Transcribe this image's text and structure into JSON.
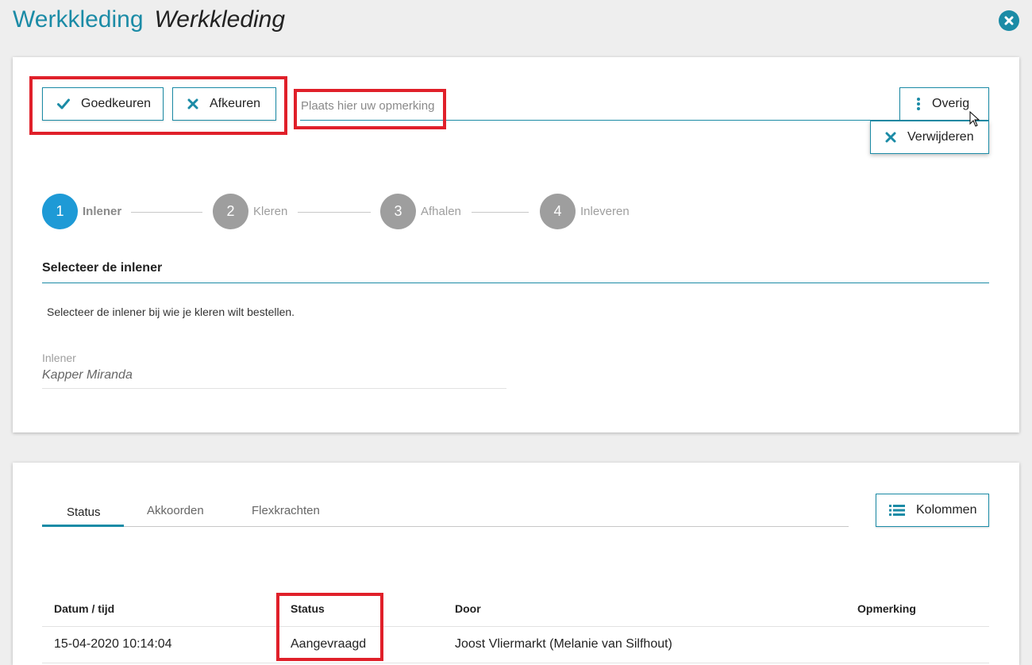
{
  "header": {
    "title": "Werkkleding",
    "subtitle": "Werkkleding"
  },
  "toolbar": {
    "approve_label": "Goedkeuren",
    "reject_label": "Afkeuren",
    "remark_placeholder": "Plaats hier uw opmerking",
    "more_label": "Overig",
    "delete_label": "Verwijderen"
  },
  "stepper": {
    "steps": [
      {
        "number": "1",
        "label": "Inlener",
        "active": true
      },
      {
        "number": "2",
        "label": "Kleren",
        "active": false
      },
      {
        "number": "3",
        "label": "Afhalen",
        "active": false
      },
      {
        "number": "4",
        "label": "Inleveren",
        "active": false
      }
    ]
  },
  "section": {
    "title": "Selecteer de inlener",
    "description": "Selecteer de inlener bij wie je kleren wilt bestellen.",
    "field_label": "Inlener",
    "field_value": "Kapper Miranda"
  },
  "history": {
    "tabs": [
      "Status",
      "Akkoorden",
      "Flexkrachten"
    ],
    "active_tab": "Status",
    "columns_label": "Kolommen",
    "headers": [
      "Datum / tijd",
      "Status",
      "Door",
      "Opmerking"
    ],
    "rows": [
      [
        "15-04-2020 10:14:04",
        "Aangevraagd",
        "Joost Vliermarkt (Melanie van Silfhout)",
        ""
      ]
    ]
  },
  "colors": {
    "accent": "#1b8ba6",
    "active_step": "#1e9ad6",
    "highlight": "#e0202a"
  },
  "icons": {
    "close": "close-circle-icon",
    "approve": "checkmark-icon",
    "reject": "x-icon",
    "more": "vertical-dots-icon",
    "delete": "x-icon",
    "columns": "list-icon"
  }
}
